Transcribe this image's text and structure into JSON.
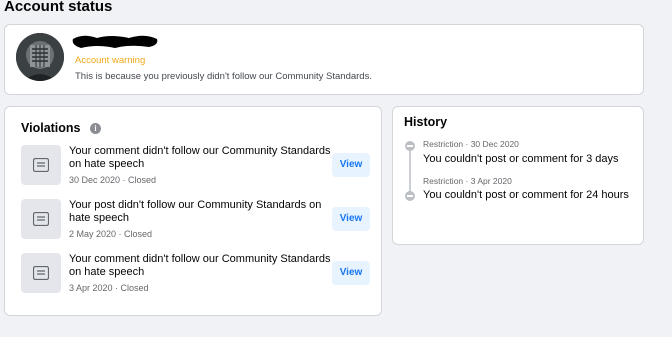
{
  "page": {
    "title": "Account status"
  },
  "status": {
    "warning": "Account warning",
    "description": "This is because you previously didn't follow our Community Standards."
  },
  "violations": {
    "title": "Violations",
    "items": [
      {
        "text": "Your comment didn't follow our Community Standards on hate speech",
        "meta": "30 Dec 2020 · Closed",
        "button": "View"
      },
      {
        "text": "Your post didn't follow our Community Standards on hate speech",
        "meta": "2 May 2020 · Closed",
        "button": "View"
      },
      {
        "text": "Your comment didn't follow our Community Standards on hate speech",
        "meta": "3 Apr 2020 · Closed",
        "button": "View"
      }
    ]
  },
  "history": {
    "title": "History",
    "items": [
      {
        "meta": "Restriction · 30 Dec 2020",
        "text": "You couldn't post or comment for 3 days"
      },
      {
        "meta": "Restriction · 3 Apr 2020",
        "text": "You couldn't post or comment for 24 hours"
      }
    ]
  },
  "colors": {
    "warning": "#f0a81a",
    "link": "#1877f2",
    "button_bg": "#e7f3ff",
    "background": "#f0f2f5"
  },
  "icons": [
    "info-icon",
    "document-icon",
    "timeline-dot-icon"
  ]
}
